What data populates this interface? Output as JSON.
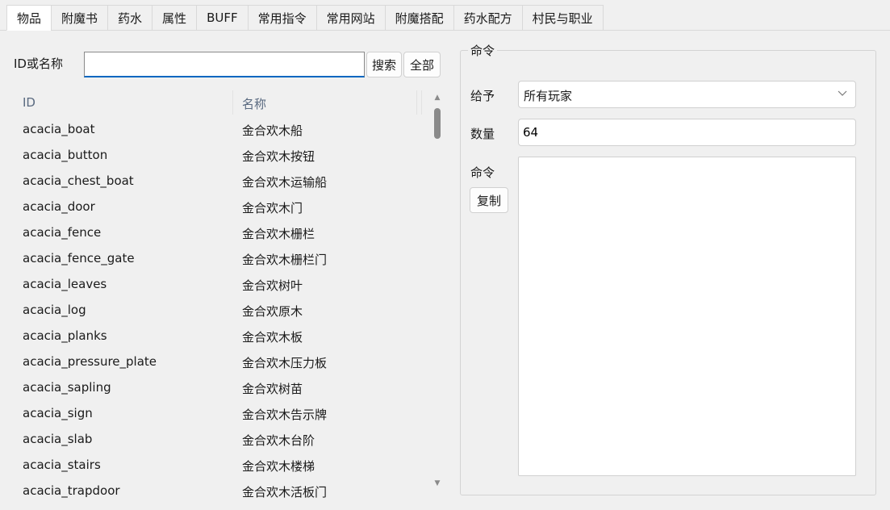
{
  "tabs": [
    {
      "label": "物品",
      "active": true
    },
    {
      "label": "附魔书",
      "active": false
    },
    {
      "label": "药水",
      "active": false
    },
    {
      "label": "属性",
      "active": false
    },
    {
      "label": "BUFF",
      "active": false
    },
    {
      "label": "常用指令",
      "active": false
    },
    {
      "label": "常用网站",
      "active": false
    },
    {
      "label": "附魔搭配",
      "active": false
    },
    {
      "label": "药水配方",
      "active": false
    },
    {
      "label": "村民与职业",
      "active": false
    }
  ],
  "search": {
    "label": "ID或名称",
    "value": "",
    "search_button": "搜索",
    "all_button": "全部"
  },
  "list": {
    "columns": {
      "id": "ID",
      "name": "名称"
    },
    "rows": [
      {
        "id": "acacia_boat",
        "name": "金合欢木船"
      },
      {
        "id": "acacia_button",
        "name": "金合欢木按钮"
      },
      {
        "id": "acacia_chest_boat",
        "name": "金合欢木运输船"
      },
      {
        "id": "acacia_door",
        "name": "金合欢木门"
      },
      {
        "id": "acacia_fence",
        "name": "金合欢木栅栏"
      },
      {
        "id": "acacia_fence_gate",
        "name": "金合欢木栅栏门"
      },
      {
        "id": "acacia_leaves",
        "name": "金合欢树叶"
      },
      {
        "id": "acacia_log",
        "name": "金合欢原木"
      },
      {
        "id": "acacia_planks",
        "name": "金合欢木板"
      },
      {
        "id": "acacia_pressure_plate",
        "name": "金合欢木压力板"
      },
      {
        "id": "acacia_sapling",
        "name": "金合欢树苗"
      },
      {
        "id": "acacia_sign",
        "name": "金合欢木告示牌"
      },
      {
        "id": "acacia_slab",
        "name": "金合欢木台阶"
      },
      {
        "id": "acacia_stairs",
        "name": "金合欢木楼梯"
      },
      {
        "id": "acacia_trapdoor",
        "name": "金合欢木活板门"
      }
    ]
  },
  "command": {
    "group_title": "命令",
    "give_label": "给予",
    "give_value": "所有玩家",
    "quantity_label": "数量",
    "quantity_value": "64",
    "command_label": "命令",
    "command_value": "",
    "copy_button": "复制"
  },
  "icons": {
    "dropdown": "chevron-down-icon",
    "scroll_up": "arrow-up-icon",
    "scroll_down": "arrow-down-icon"
  },
  "colors": {
    "accent": "#0067c0",
    "background": "#f0f0f0"
  }
}
